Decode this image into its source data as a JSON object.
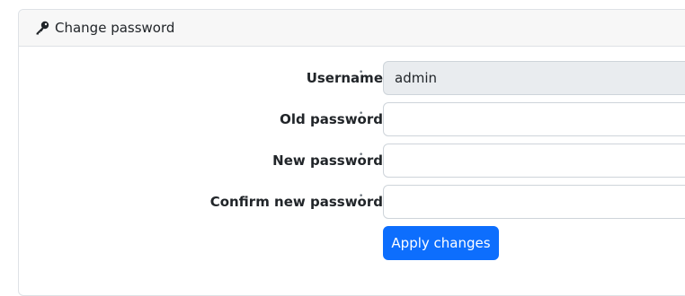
{
  "card": {
    "title": "Change password",
    "icon": "key-icon"
  },
  "form": {
    "required_marker": "•",
    "fields": [
      {
        "label": "Username",
        "value": "admin",
        "readonly": true
      },
      {
        "label": "Old password",
        "value": ""
      },
      {
        "label": "New password",
        "value": ""
      },
      {
        "label": "Confirm new password",
        "value": ""
      }
    ],
    "submit_label": "Apply changes"
  },
  "colors": {
    "primary": "#0d6efd",
    "header_bg": "#f7f7f7",
    "readonly_bg": "#e9ecef"
  }
}
